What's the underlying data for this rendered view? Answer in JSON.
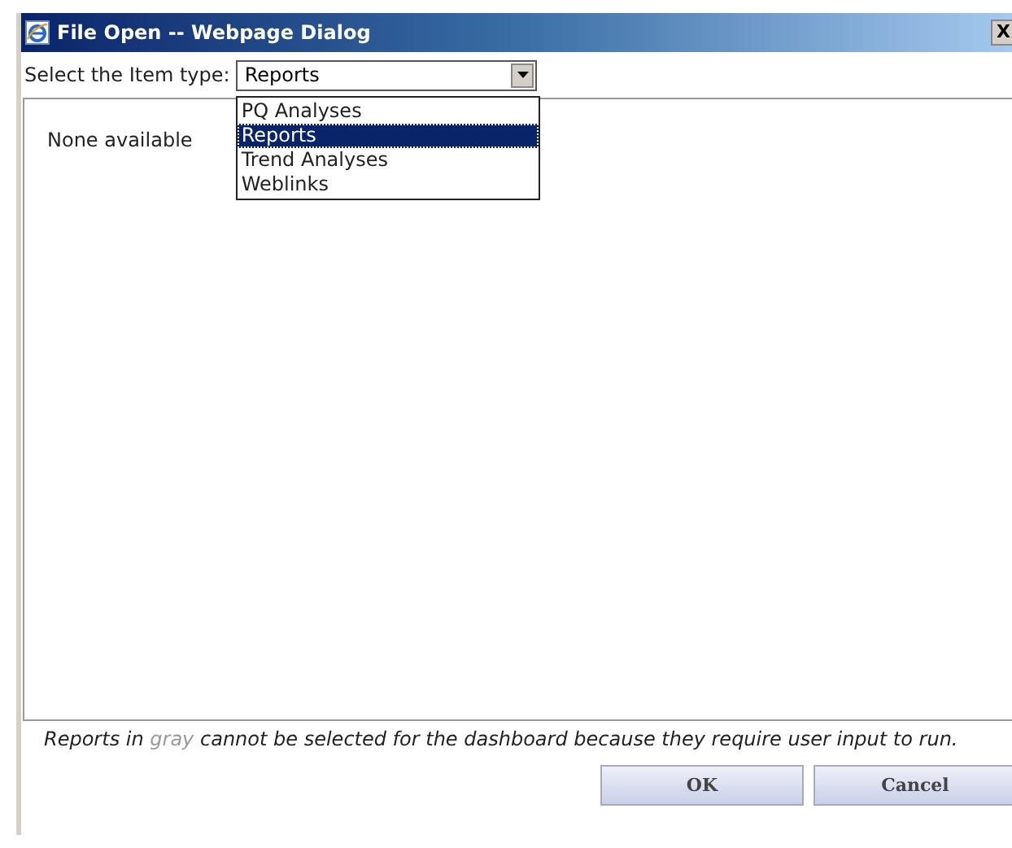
{
  "window": {
    "title": "File Open -- Webpage Dialog",
    "close": "X"
  },
  "item_type": {
    "label": "Select the Item type:",
    "value": "Reports",
    "expanded": true,
    "options": [
      {
        "label": "PQ Analyses",
        "selected": false
      },
      {
        "label": "Reports",
        "selected": true
      },
      {
        "label": "Trend Analyses",
        "selected": false
      },
      {
        "label": "Weblinks",
        "selected": false
      }
    ]
  },
  "list": {
    "empty_text": "None available"
  },
  "note": {
    "before": "Reports in",
    "highlight": "gray",
    "after": "cannot be selected for the dashboard because they require user input to run."
  },
  "buttons": [
    {
      "label": "OK"
    },
    {
      "label": "Cancel"
    }
  ]
}
